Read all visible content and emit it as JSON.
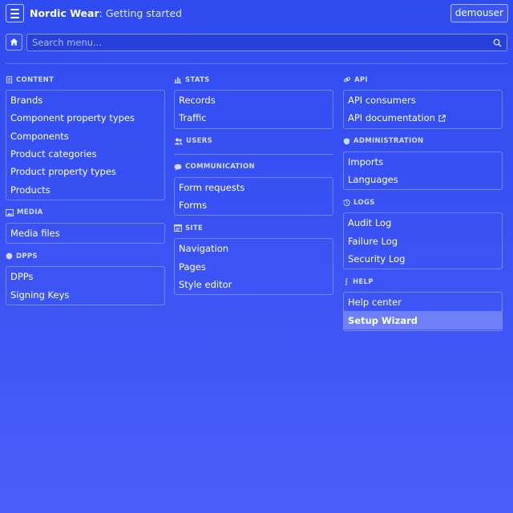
{
  "header": {
    "brand": "Nordic Wear",
    "separator": ":",
    "page": "Getting started",
    "user": "demouser"
  },
  "search": {
    "placeholder": "Search menu..."
  },
  "icons": {
    "menu": "hamburger-icon",
    "home": "home-icon",
    "search": "search-icon",
    "external": "external-link-icon"
  },
  "columns": [
    [
      {
        "key": "content",
        "title": "CONTENT",
        "icon": "document-icon",
        "items": [
          "Brands",
          "Component property types",
          "Components",
          "Product categories",
          "Product property types",
          "Products"
        ]
      },
      {
        "key": "media",
        "title": "MEDIA",
        "icon": "image-icon",
        "items": [
          "Media files"
        ]
      },
      {
        "key": "dpps",
        "title": "DPPS",
        "icon": "circle-icon",
        "items": [
          "DPPs",
          "Signing Keys"
        ]
      }
    ],
    [
      {
        "key": "stats",
        "title": "STATS",
        "icon": "bar-chart-icon",
        "items": [
          "Records",
          "Traffic"
        ]
      },
      {
        "key": "users",
        "title": "USERS",
        "icon": "users-icon",
        "items": []
      },
      {
        "key": "communication",
        "title": "COMMUNICATION",
        "icon": "chat-icon",
        "items": [
          "Form requests",
          "Forms"
        ]
      },
      {
        "key": "site",
        "title": "SITE",
        "icon": "window-icon",
        "items": [
          "Navigation",
          "Pages",
          "Style editor"
        ]
      }
    ],
    [
      {
        "key": "api",
        "title": "API",
        "icon": "link-icon",
        "items": [
          "API consumers",
          "API documentation"
        ]
      },
      {
        "key": "administration",
        "title": "ADMINISTRATION",
        "icon": "shield-icon",
        "items": [
          "Imports",
          "Languages"
        ]
      },
      {
        "key": "logs",
        "title": "LOGS",
        "icon": "history-icon",
        "items": [
          "Audit Log",
          "Failure Log",
          "Security Log"
        ]
      },
      {
        "key": "help",
        "title": "HELP",
        "icon": "info-icon",
        "items": [
          "Help center",
          "Setup Wizard"
        ]
      }
    ]
  ],
  "external_items": [
    "API documentation"
  ],
  "active_item": "Setup Wizard",
  "colors": {
    "accent": "#2f4cf0",
    "active_bg": "#6f86fb"
  }
}
